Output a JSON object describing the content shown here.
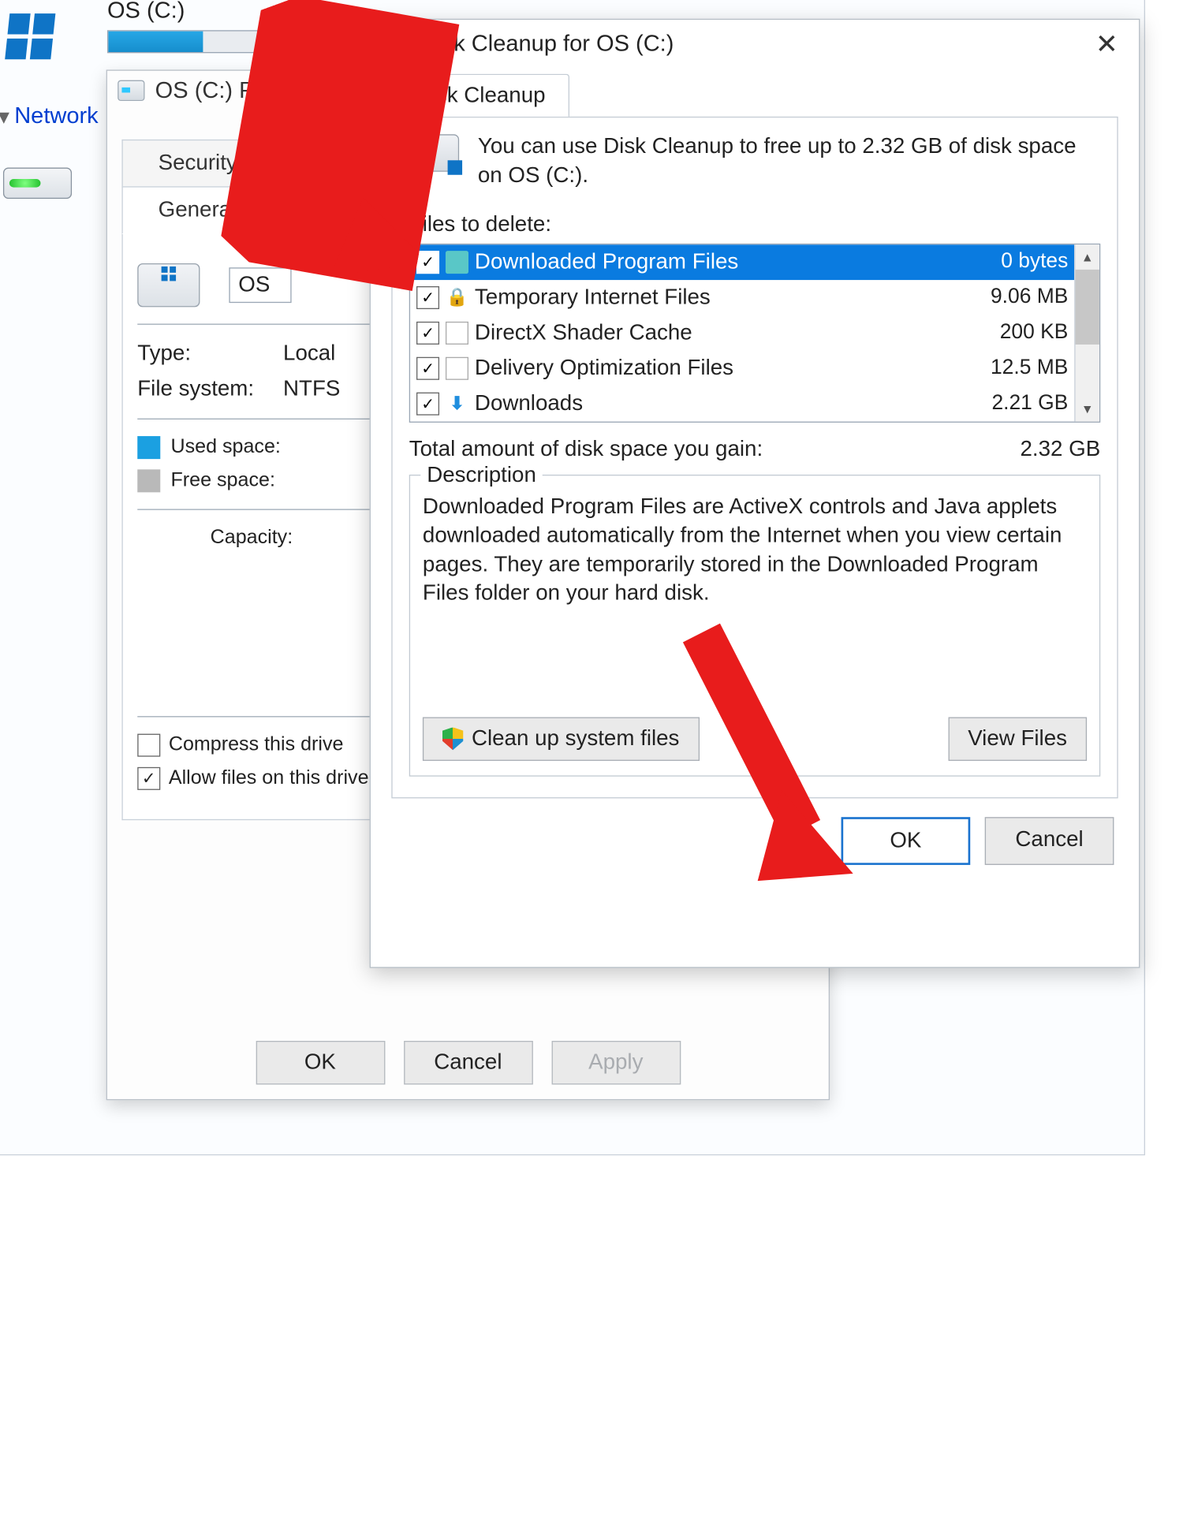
{
  "explorer": {
    "drive_title": "OS (C:)",
    "network_label": "Network"
  },
  "properties": {
    "title": "OS (C:) Properties",
    "tabs": {
      "security": "Security",
      "general": "General"
    },
    "name_value": "OS",
    "type_label": "Type:",
    "type_value": "Local",
    "fs_label": "File system:",
    "fs_value": "NTFS",
    "used_label": "Used space:",
    "free_label": "Free space:",
    "capacity_label": "Capacity:",
    "compress_label": "Compress this drive",
    "allow_label": "Allow files on this drive file properties",
    "buttons": {
      "ok": "OK",
      "cancel": "Cancel",
      "apply": "Apply"
    }
  },
  "cleanup": {
    "title": "Disk Cleanup for OS (C:)",
    "tab": "Disk Cleanup",
    "intro": "You can use Disk Cleanup to free up to 2.32 GB of disk space on OS (C:).",
    "files_label": "Files to delete:",
    "files": [
      {
        "name": "Downloaded Program Files",
        "size": "0 bytes",
        "checked": true,
        "selected": true,
        "icon": "folder"
      },
      {
        "name": "Temporary Internet Files",
        "size": "9.06 MB",
        "checked": true,
        "selected": false,
        "icon": "lock"
      },
      {
        "name": "DirectX Shader Cache",
        "size": "200 KB",
        "checked": true,
        "selected": false,
        "icon": "doc"
      },
      {
        "name": "Delivery Optimization Files",
        "size": "12.5 MB",
        "checked": true,
        "selected": false,
        "icon": "doc"
      },
      {
        "name": "Downloads",
        "size": "2.21 GB",
        "checked": true,
        "selected": false,
        "icon": "down"
      }
    ],
    "total_label": "Total amount of disk space you gain:",
    "total_value": "2.32 GB",
    "description_label": "Description",
    "description_text": "Downloaded Program Files are ActiveX controls and Java applets downloaded automatically from the Internet when you view certain pages. They are temporarily stored in the Downloaded Program Files folder on your hard disk.",
    "clean_system": "Clean up system files",
    "view_files": "View Files",
    "ok": "OK",
    "cancel": "Cancel"
  }
}
